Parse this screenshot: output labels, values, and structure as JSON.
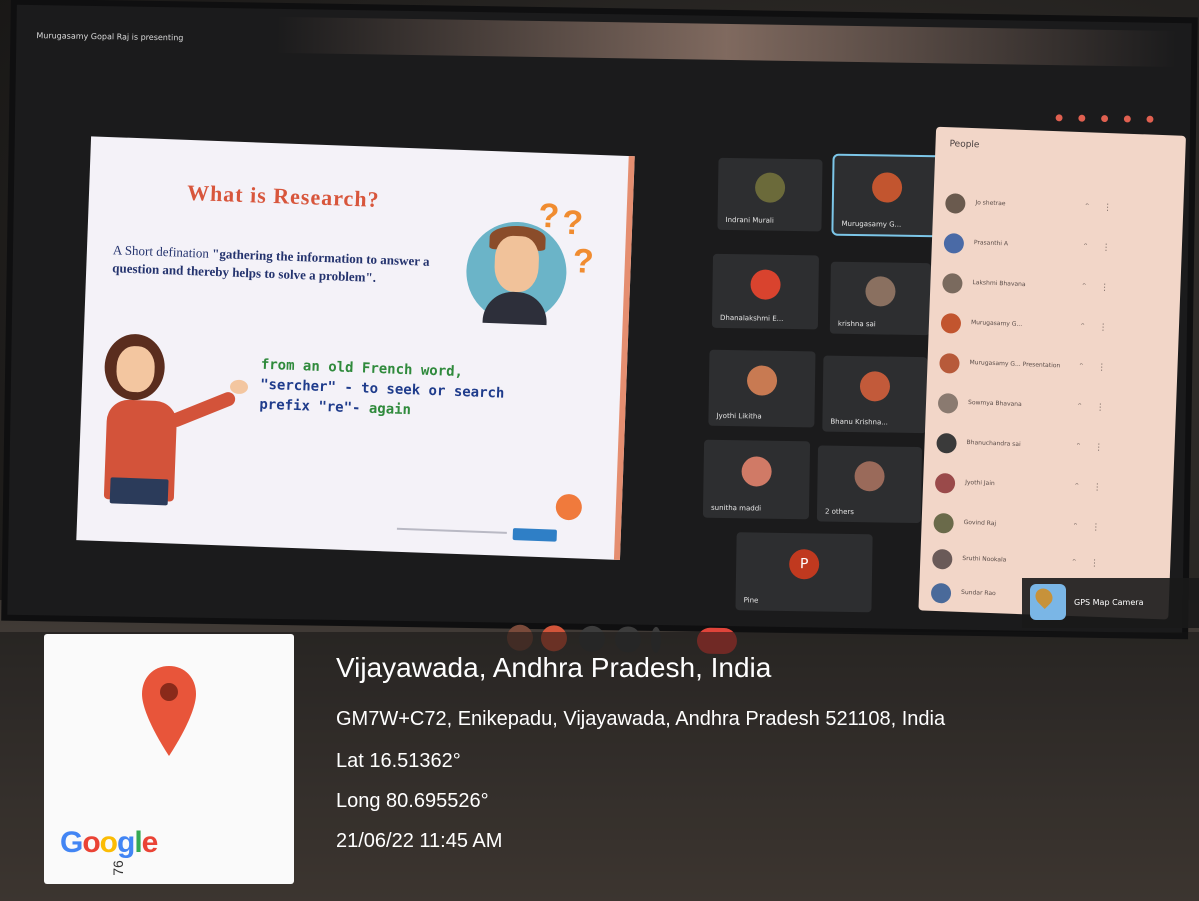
{
  "meeting": {
    "presenting_label": "Murugasamy Gopal Raj is presenting"
  },
  "slide": {
    "title": "What is Research?",
    "definition_intro": "A Short defination ",
    "definition_bold": "\"gathering the information to answer a question and thereby helps to solve a problem\".",
    "french_line1": "from an old French word,",
    "french_line2": "\"sercher\" - to seek or search",
    "french_line3_prefix": "prefix \"re\"- ",
    "french_line3_again": "again",
    "question_mark": "?"
  },
  "tiles": [
    {
      "name": "Indrani Murali",
      "color": "#6b6a3a"
    },
    {
      "name": "Murugasamy G...",
      "color": "#c2552f"
    },
    {
      "name": "Dhanalakshmi E...",
      "color": "#d9432e"
    },
    {
      "name": "krishna sai",
      "color": "#8a7060"
    },
    {
      "name": "Jyothi Likitha",
      "color": "#c87a52"
    },
    {
      "name": "Bhanu Krishna...",
      "color": "#c25a3a"
    },
    {
      "name": "sunitha maddi",
      "color": "#d07a66"
    },
    {
      "name": "2 others",
      "color": "#9a6a5a"
    },
    {
      "name": "Pine",
      "color": "#c0391f",
      "initial": "P"
    }
  ],
  "people": {
    "title": "People",
    "list": [
      {
        "name": "Jo shetrae",
        "color": "#6a5a4e"
      },
      {
        "name": "Prasanthi A",
        "color": "#4a6aa6"
      },
      {
        "name": "Lakshmi Bhavana",
        "color": "#7a6a5e"
      },
      {
        "name": "Murugasamy G...",
        "color": "#c2552f"
      },
      {
        "name": "Murugasamy G... Presentation",
        "color": "#b75a3a"
      },
      {
        "name": "Sowmya Bhavana",
        "color": "#8a7a70"
      },
      {
        "name": "Bhanuchandra sai",
        "color": "#3a3a3a"
      },
      {
        "name": "Jyothi Jain",
        "color": "#9a4a4a"
      },
      {
        "name": "Govind Raj",
        "color": "#6a6a4a"
      },
      {
        "name": "Sruthi Nookala",
        "color": "#6a5a58"
      },
      {
        "name": "Sundar Rao",
        "color": "#4a6a9a"
      }
    ]
  },
  "gps_app": {
    "label": "GPS Map Camera"
  },
  "location": {
    "city": "Vijayawada, Andhra Pradesh, India",
    "address": "GM7W+C72, Enikepadu, Vijayawada, Andhra Pradesh 521108, India",
    "lat": "Lat 16.51362°",
    "long": "Long 80.695526°",
    "datetime": "21/06/22 11:45 AM"
  },
  "map": {
    "brand": "Google",
    "pin_color": "#e8553a",
    "map_number": "76"
  }
}
